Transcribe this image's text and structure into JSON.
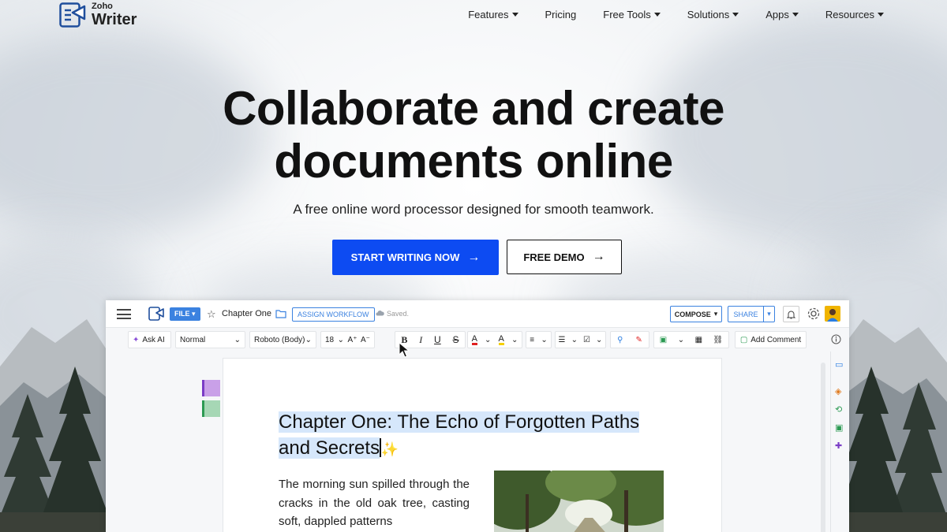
{
  "brand": {
    "small": "Zoho",
    "big": "Writer"
  },
  "nav": [
    {
      "label": "Features",
      "dropdown": true
    },
    {
      "label": "Pricing",
      "dropdown": false
    },
    {
      "label": "Free Tools",
      "dropdown": true
    },
    {
      "label": "Solutions",
      "dropdown": true
    },
    {
      "label": "Apps",
      "dropdown": true
    },
    {
      "label": "Resources",
      "dropdown": true
    }
  ],
  "hero": {
    "title_line1": "Collaborate and create",
    "title_line2": "documents online",
    "subtitle": "A free online word processor designed for smooth teamwork.",
    "primary_cta": "START WRITING NOW",
    "secondary_cta": "FREE DEMO"
  },
  "app": {
    "file_label": "FILE",
    "doc_title": "Chapter One",
    "assign_workflow": "ASSIGN WORKFLOW",
    "saved_status": "Saved.",
    "compose": "COMPOSE",
    "share": "SHARE",
    "toolbar": {
      "ask_ai": "Ask AI",
      "style": "Normal",
      "font": "Roboto (Body)",
      "size": "18",
      "add_comment": "Add Comment"
    },
    "document": {
      "title_line1": "Chapter One: The Echo of Forgotten Paths",
      "title_line2": "and Secrets",
      "paragraph": "The morning sun spilled through the cracks in the old oak tree, casting soft, dappled patterns"
    }
  },
  "colors": {
    "primary_blue": "#0d4bf2",
    "app_accent": "#3b82e0",
    "highlight": "#d6e7fb"
  },
  "icons": [
    "logo-icon",
    "caret-down-icon",
    "arrow-right-icon",
    "hamburger-icon",
    "document-icon",
    "star-icon",
    "folder-icon",
    "cloud-icon",
    "bell-icon",
    "gear-icon",
    "sparkle-icon",
    "bold-icon",
    "italic-icon",
    "underline-icon",
    "strikethrough-icon",
    "info-icon",
    "cursor-icon"
  ]
}
